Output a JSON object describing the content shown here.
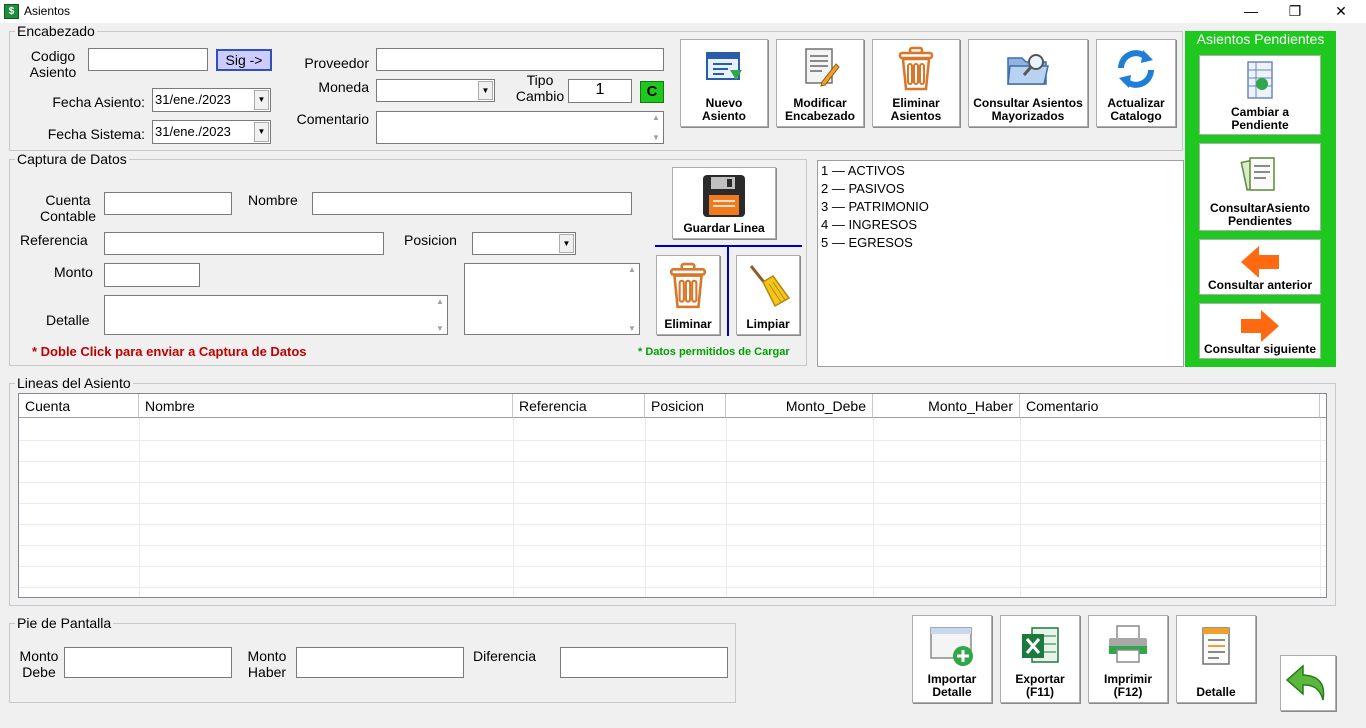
{
  "window": {
    "title": "Asientos",
    "minimize": "—",
    "maximize": "❐",
    "close": "✕"
  },
  "encabezado": {
    "legend": "Encabezado",
    "codigo_label": "Codigo\nAsiento",
    "codigo_value": "",
    "sig_label": "Sig ->",
    "fecha_asiento_label": "Fecha Asiento:",
    "fecha_asiento_value": "31/ene./2023",
    "fecha_sistema_label": "Fecha Sistema:",
    "fecha_sistema_value": "31/ene./2023",
    "proveedor_label": "Proveedor",
    "proveedor_value": "",
    "moneda_label": "Moneda",
    "moneda_value": "",
    "tipo_cambio_label": "Tipo\nCambio",
    "tipo_cambio_value": "1",
    "c_label": "C",
    "comentario_label": "Comentario",
    "comentario_value": ""
  },
  "toolbar": [
    {
      "label": "Nuevo\nAsiento"
    },
    {
      "label": "Modificar\nEncabezado"
    },
    {
      "label": "Eliminar\nAsientos"
    },
    {
      "label": "Consultar Asientos\nMayorizados"
    },
    {
      "label": "Actualizar\nCatalogo"
    }
  ],
  "captura": {
    "legend": "Captura de Datos",
    "cuenta_label": "Cuenta\nContable",
    "cuenta_value": "",
    "nombre_label": "Nombre",
    "nombre_value": "",
    "referencia_label": "Referencia",
    "referencia_value": "",
    "posicion_label": "Posicion",
    "posicion_value": "",
    "monto_label": "Monto",
    "monto_value": "",
    "detalle_label": "Detalle",
    "detalle_value": "",
    "note": "* Doble Click para enviar a Captura de Datos",
    "guardar_label": "Guardar Linea",
    "eliminar_label": "Eliminar",
    "limpiar_label": "Limpiar",
    "permitidos_note": "* Datos permitidos de Cargar"
  },
  "catalog": [
    {
      "code": "1",
      "name": "ACTIVOS"
    },
    {
      "code": "2",
      "name": "PASIVOS"
    },
    {
      "code": "3",
      "name": "PATRIMONIO"
    },
    {
      "code": "4",
      "name": "INGRESOS"
    },
    {
      "code": "5",
      "name": "EGRESOS"
    }
  ],
  "pendientes": {
    "title": "Asientos Pendientes",
    "buttons": [
      {
        "label": "Cambiar a\nPendiente"
      },
      {
        "label": "ConsultarAsiento\nPendientes"
      },
      {
        "label": "Consultar anterior"
      },
      {
        "label": "Consultar siguiente"
      }
    ]
  },
  "lineas": {
    "legend": "Lineas del Asiento",
    "columns": [
      "Cuenta",
      "Nombre",
      "Referencia",
      "Posicion",
      "Monto_Debe",
      "Monto_Haber",
      "Comentario"
    ]
  },
  "pie": {
    "legend": "Pie de Pantalla",
    "debe_label": "Monto\nDebe",
    "debe_value": "",
    "haber_label": "Monto\nHaber",
    "haber_value": "",
    "diferencia_label": "Diferencia",
    "diferencia_value": ""
  },
  "bottom_buttons": [
    {
      "label": "Importar\nDetalle"
    },
    {
      "label": "Exportar\n(F11)"
    },
    {
      "label": "Imprimir\n(F12)"
    },
    {
      "label": "Detalle"
    }
  ],
  "colors": {
    "green_panel": "#1ec81e",
    "note_red": "#c00000",
    "note_green": "#00a000",
    "separator_blue": "#0000c0"
  }
}
